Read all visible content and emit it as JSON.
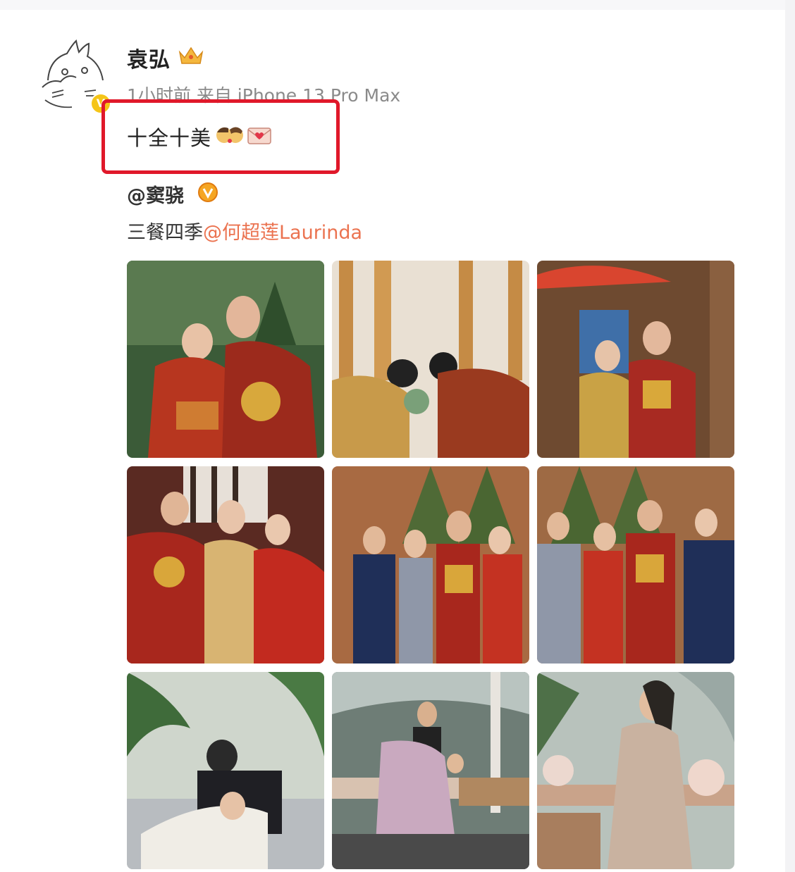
{
  "post": {
    "username": "袁弘",
    "meta": "1小时前  来自 iPhone 13 Pro Max",
    "text": "十全十美",
    "emojis": [
      "kiss-emoji",
      "love-letter-emoji"
    ]
  },
  "repost": {
    "user": "@窦骁",
    "text_prefix": "三餐四季",
    "mention": "@何超莲Laurinda"
  },
  "colors": {
    "highlight_border": "#e0182a",
    "mention": "#eb7350",
    "verified_gold": "#f5c518",
    "meta_gray": "#8a8a8a"
  },
  "photos": [
    {
      "name": "photo-couple-red-garden"
    },
    {
      "name": "photo-couple-bowing"
    },
    {
      "name": "photo-couple-red-umbrella"
    },
    {
      "name": "photo-family-seated"
    },
    {
      "name": "photo-group-four-left"
    },
    {
      "name": "photo-group-four-right"
    },
    {
      "name": "photo-couple-lounge"
    },
    {
      "name": "photo-couple-dance"
    },
    {
      "name": "photo-bride-gown-table"
    }
  ]
}
